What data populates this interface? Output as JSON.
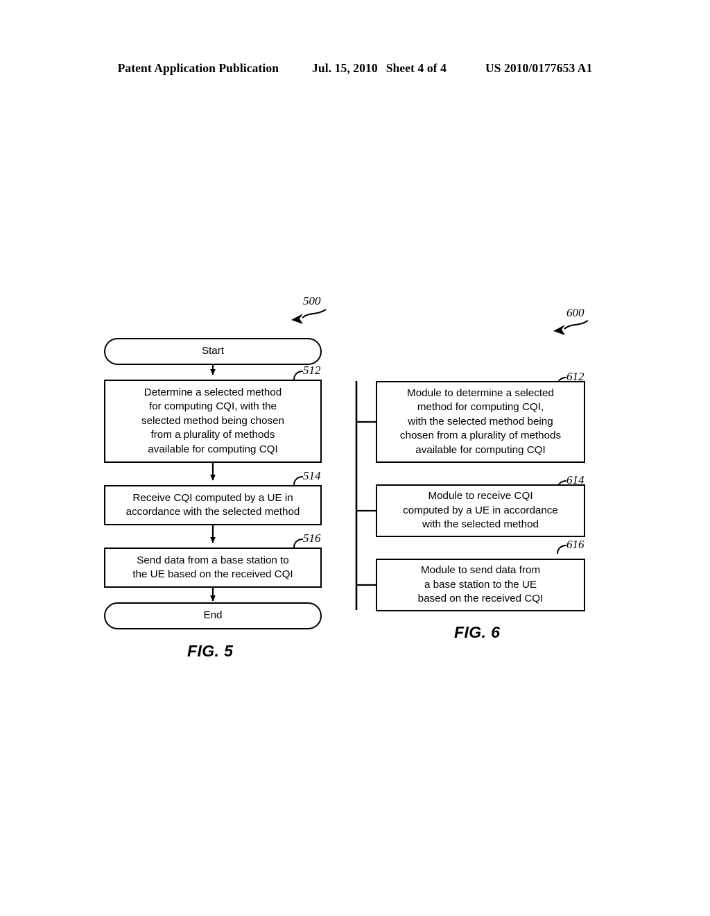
{
  "header": {
    "title": "Patent Application Publication",
    "date": "Jul. 15, 2010",
    "sheet": "Sheet 4 of 4",
    "publication_number": "US 2010/0177653 A1"
  },
  "figures": [
    {
      "caption": "FIG. 5",
      "figure_ref": "500",
      "type": "flowchart",
      "nodes": [
        {
          "ref": "",
          "shape": "terminator",
          "text": "Start"
        },
        {
          "ref": "512",
          "shape": "process",
          "text": "Determine a selected method\nfor computing CQI, with the\nselected method being chosen\nfrom a plurality of methods\navailable for computing CQI"
        },
        {
          "ref": "514",
          "shape": "process",
          "text": "Receive CQI computed by a UE in\naccordance with the selected method"
        },
        {
          "ref": "516",
          "shape": "process",
          "text": "Send data from a base station to\nthe UE based on the received CQI"
        },
        {
          "ref": "",
          "shape": "terminator",
          "text": "End"
        }
      ]
    },
    {
      "caption": "FIG. 6",
      "figure_ref": "600",
      "type": "module-block-diagram",
      "nodes": [
        {
          "ref": "612",
          "shape": "module",
          "text": "Module to determine a selected\nmethod for computing CQI,\nwith the selected method being\nchosen from a plurality of methods\navailable for computing CQI"
        },
        {
          "ref": "614",
          "shape": "module",
          "text": "Module to receive CQI\ncomputed by a UE in accordance\nwith the selected method"
        },
        {
          "ref": "616",
          "shape": "module",
          "text": "Module to send data from\na base station to the UE\nbased on the received CQI"
        }
      ]
    }
  ],
  "colors": {
    "ink": "#000000",
    "paper": "#ffffff"
  }
}
